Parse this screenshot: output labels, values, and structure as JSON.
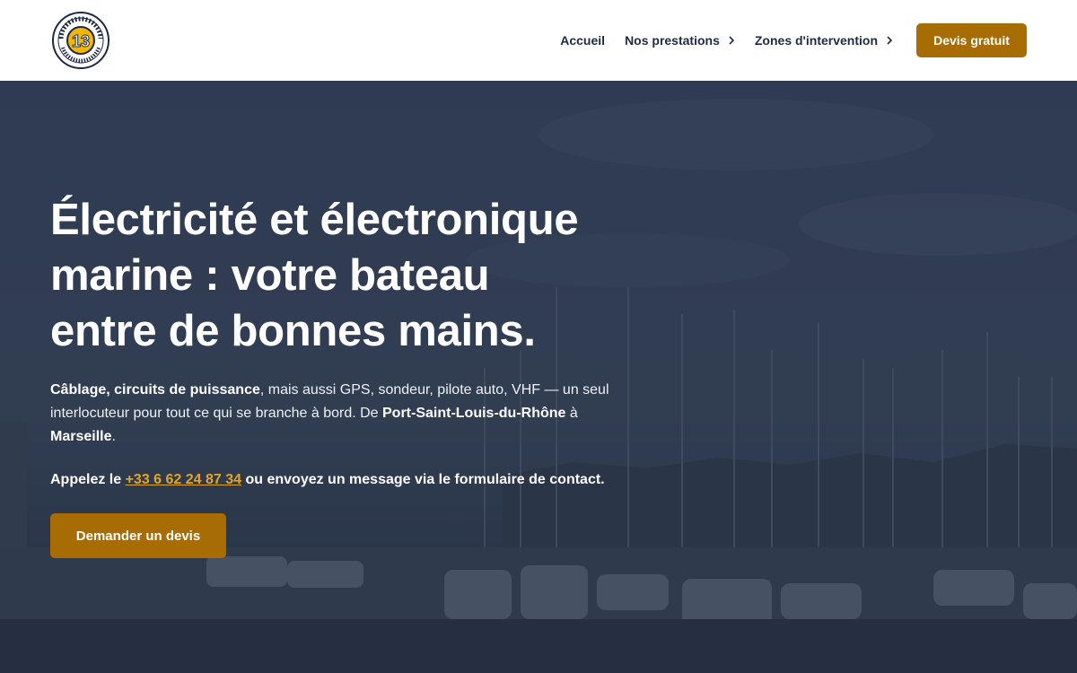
{
  "brand": {
    "logo_icon": "elec-nautic-13-logo",
    "logo_text_top": "ELEC NAUTIC",
    "logo_number": "13",
    "logo_text_bottom": "ÉLECTRICIEN NAUTIQUE"
  },
  "nav": {
    "items": [
      {
        "label": "Accueil"
      },
      {
        "label": "Nos prestations",
        "icon": "chevron-right-icon"
      },
      {
        "label": "Zones d'intervention",
        "icon": "chevron-right-icon"
      }
    ],
    "cta_label": "Devis gratuit"
  },
  "hero": {
    "title": "Électricité et électronique marine : votre bateau entre de bonnes mains.",
    "text": {
      "bold1": "Câblage, circuits de puissance",
      "part1": ", mais aussi GPS, sondeur, pilote auto, VHF — un seul interlocuteur pour tout ce qui se branche à bord. De ",
      "bold2": "Port-Saint-Louis-du-Rhône",
      "part2": " à ",
      "bold3": "Marseille",
      "part3": "."
    },
    "call": {
      "prefix": "Appelez le ",
      "phone": "+33 6 62 24 87 34",
      "suffix": " ou envoyez un message via le formulaire de contact."
    },
    "cta_label": "Demander un devis"
  },
  "colors": {
    "accent": "#a86c04",
    "phone_link": "#e4a524",
    "nav_text": "#1f2a44",
    "hero_overlay": "#2f3b52"
  }
}
